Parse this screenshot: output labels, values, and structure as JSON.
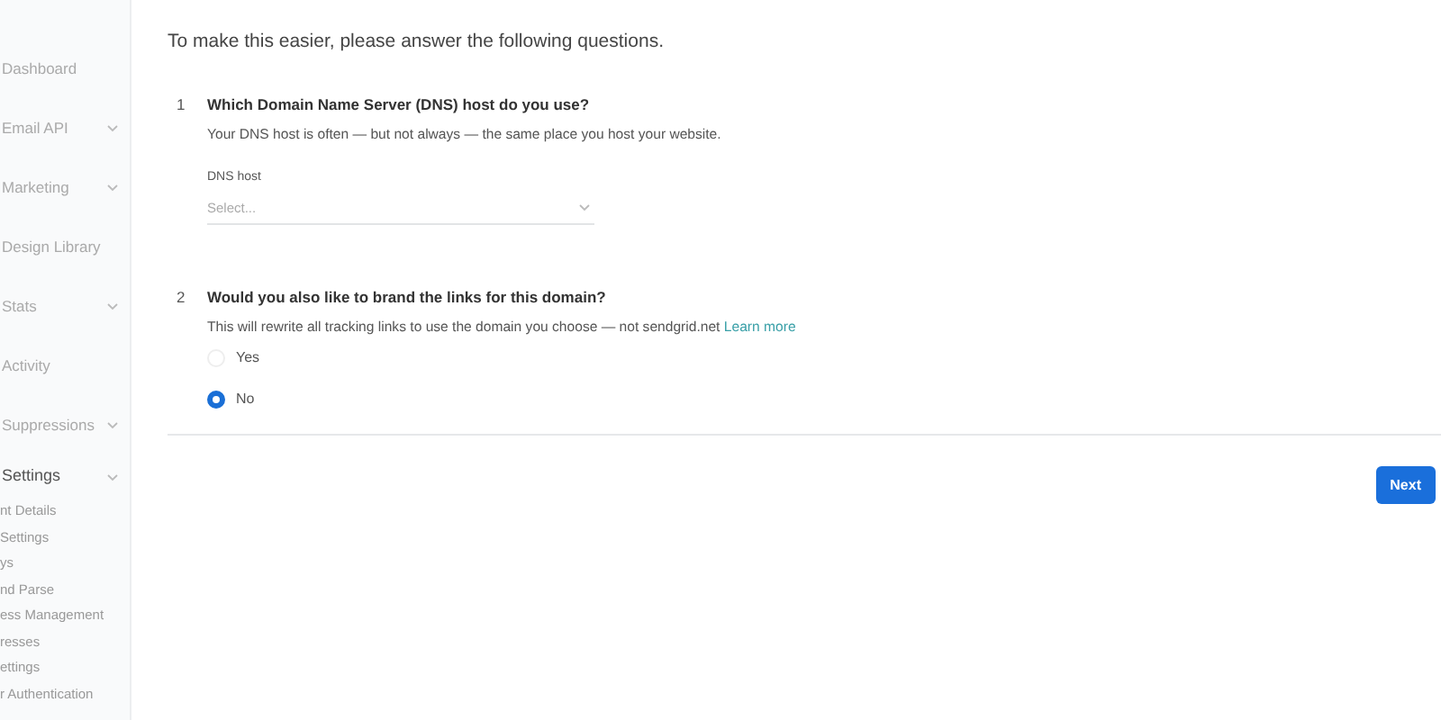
{
  "sidebar": {
    "items": [
      {
        "label": "Dashboard",
        "expandable": false,
        "expanded": false
      },
      {
        "label": "Email API",
        "expandable": true,
        "expanded": false
      },
      {
        "label": "Marketing",
        "expandable": true,
        "expanded": false
      },
      {
        "label": "Design Library",
        "expandable": false,
        "expanded": false
      },
      {
        "label": "Stats",
        "expandable": true,
        "expanded": false
      },
      {
        "label": "Activity",
        "expandable": false,
        "expanded": false
      },
      {
        "label": "Suppressions",
        "expandable": true,
        "expanded": false
      },
      {
        "label": "Settings",
        "expandable": true,
        "expanded": true,
        "children": [
          {
            "label": "nt Details"
          },
          {
            "label": "Settings"
          },
          {
            "label": "ys"
          },
          {
            "label": "nd Parse"
          },
          {
            "label": "ess Management"
          },
          {
            "label": "resses"
          },
          {
            "label": "ettings"
          },
          {
            "label": "r Authentication"
          }
        ]
      }
    ]
  },
  "intro": "To make this easier, please answer the following questions.",
  "questions": [
    {
      "number": "1",
      "title": "Which Domain Name Server (DNS) host do you use?",
      "description": "Your DNS host is often — but not always — the same place you host your website.",
      "kind": "select",
      "field": {
        "label": "DNS host",
        "placeholder": "Select..."
      }
    },
    {
      "number": "2",
      "title": "Would you also like to brand the links for this domain?",
      "description": "This will rewrite all tracking links to use the domain you choose — not sendgrid.net",
      "link": "Learn more",
      "kind": "radio",
      "options": [
        {
          "label": "Yes",
          "selected": false
        },
        {
          "label": "No",
          "selected": true
        }
      ]
    }
  ],
  "buttons": [
    {
      "label": "Next"
    }
  ]
}
